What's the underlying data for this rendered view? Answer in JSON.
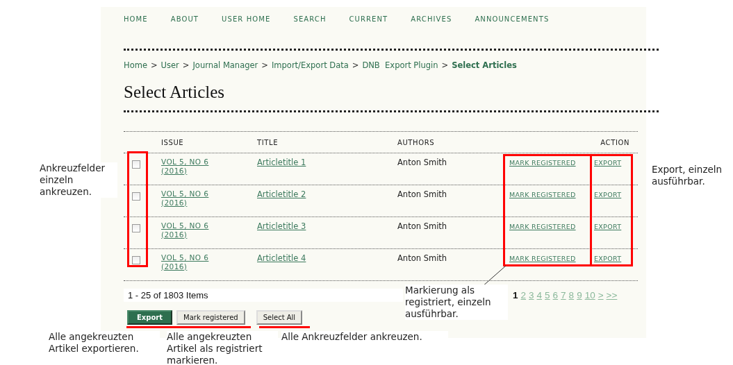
{
  "nav": [
    {
      "label": "HOME"
    },
    {
      "label": "ABOUT"
    },
    {
      "label": "USER HOME"
    },
    {
      "label": "SEARCH"
    },
    {
      "label": "CURRENT"
    },
    {
      "label": "ARCHIVES"
    },
    {
      "label": "ANNOUNCEMENTS"
    }
  ],
  "breadcrumb": [
    {
      "kind": "link",
      "label": "Home",
      "current": false
    },
    {
      "kind": "separator",
      "label": ">"
    },
    {
      "kind": "link",
      "label": "User",
      "current": false
    },
    {
      "kind": "separator",
      "label": ">"
    },
    {
      "kind": "link",
      "label": "Journal Manager",
      "current": false
    },
    {
      "kind": "separator",
      "label": ">"
    },
    {
      "kind": "link",
      "label": "Import/Export Data",
      "current": false
    },
    {
      "kind": "separator",
      "label": ">"
    },
    {
      "kind": "link",
      "label": "DNB  Export Plugin",
      "current": false
    },
    {
      "kind": "separator",
      "label": ">"
    },
    {
      "kind": "link",
      "label": "Select Articles",
      "current": true
    }
  ],
  "page_title": "Select Articles",
  "table": {
    "columns": [
      "ISSUE",
      "TITLE",
      "AUTHORS",
      "ACTION"
    ],
    "rows": [
      {
        "checked": false,
        "issue": "VOL 5, NO 6 (2016)",
        "title": "Articletitle 1",
        "authors": "Anton Smith",
        "actions": [
          "MARK REGISTERED",
          "EXPORT"
        ]
      },
      {
        "checked": false,
        "issue": "VOL 5, NO 6 (2016)",
        "title": "Articletitle 2",
        "authors": "Anton Smith",
        "actions": [
          "MARK REGISTERED",
          "EXPORT"
        ]
      },
      {
        "checked": false,
        "issue": "VOL 5, NO 6 (2016)",
        "title": "Articletitle 3",
        "authors": "Anton Smith",
        "actions": [
          "MARK REGISTERED",
          "EXPORT"
        ]
      },
      {
        "checked": false,
        "issue": "VOL 5, NO 6 (2016)",
        "title": "Articletitle 4",
        "authors": "Anton Smith",
        "actions": [
          "MARK REGISTERED",
          "EXPORT"
        ]
      }
    ]
  },
  "items_count": "1 - 25 of 1803 Items",
  "pagination": [
    {
      "label": "1",
      "selected": true
    },
    {
      "label": "2",
      "selected": false
    },
    {
      "label": "3",
      "selected": false
    },
    {
      "label": "4",
      "selected": false
    },
    {
      "label": "5",
      "selected": false
    },
    {
      "label": "6",
      "selected": false
    },
    {
      "label": "7",
      "selected": false
    },
    {
      "label": "8",
      "selected": false
    },
    {
      "label": "9",
      "selected": false
    },
    {
      "label": "10",
      "selected": false
    },
    {
      "label": ">",
      "selected": false
    },
    {
      "label": ">>",
      "selected": false
    }
  ],
  "buttons": [
    {
      "label": "Export",
      "kind": "primary"
    },
    {
      "label": "Mark registered",
      "kind": "default"
    },
    {
      "label": "Select All",
      "kind": "default"
    }
  ],
  "annotations": [
    "Ankreuzfelder einzeln ankreuzen.",
    "Export, einzeln ausführbar.",
    "Markierung als registriert, einzeln ausführbar.",
    "Alle angekreuzten Artikel exportieren.",
    "Alle angekreuzten Artikel als registriert markieren.",
    "Alle Ankreuzfelder ankreuzen."
  ]
}
